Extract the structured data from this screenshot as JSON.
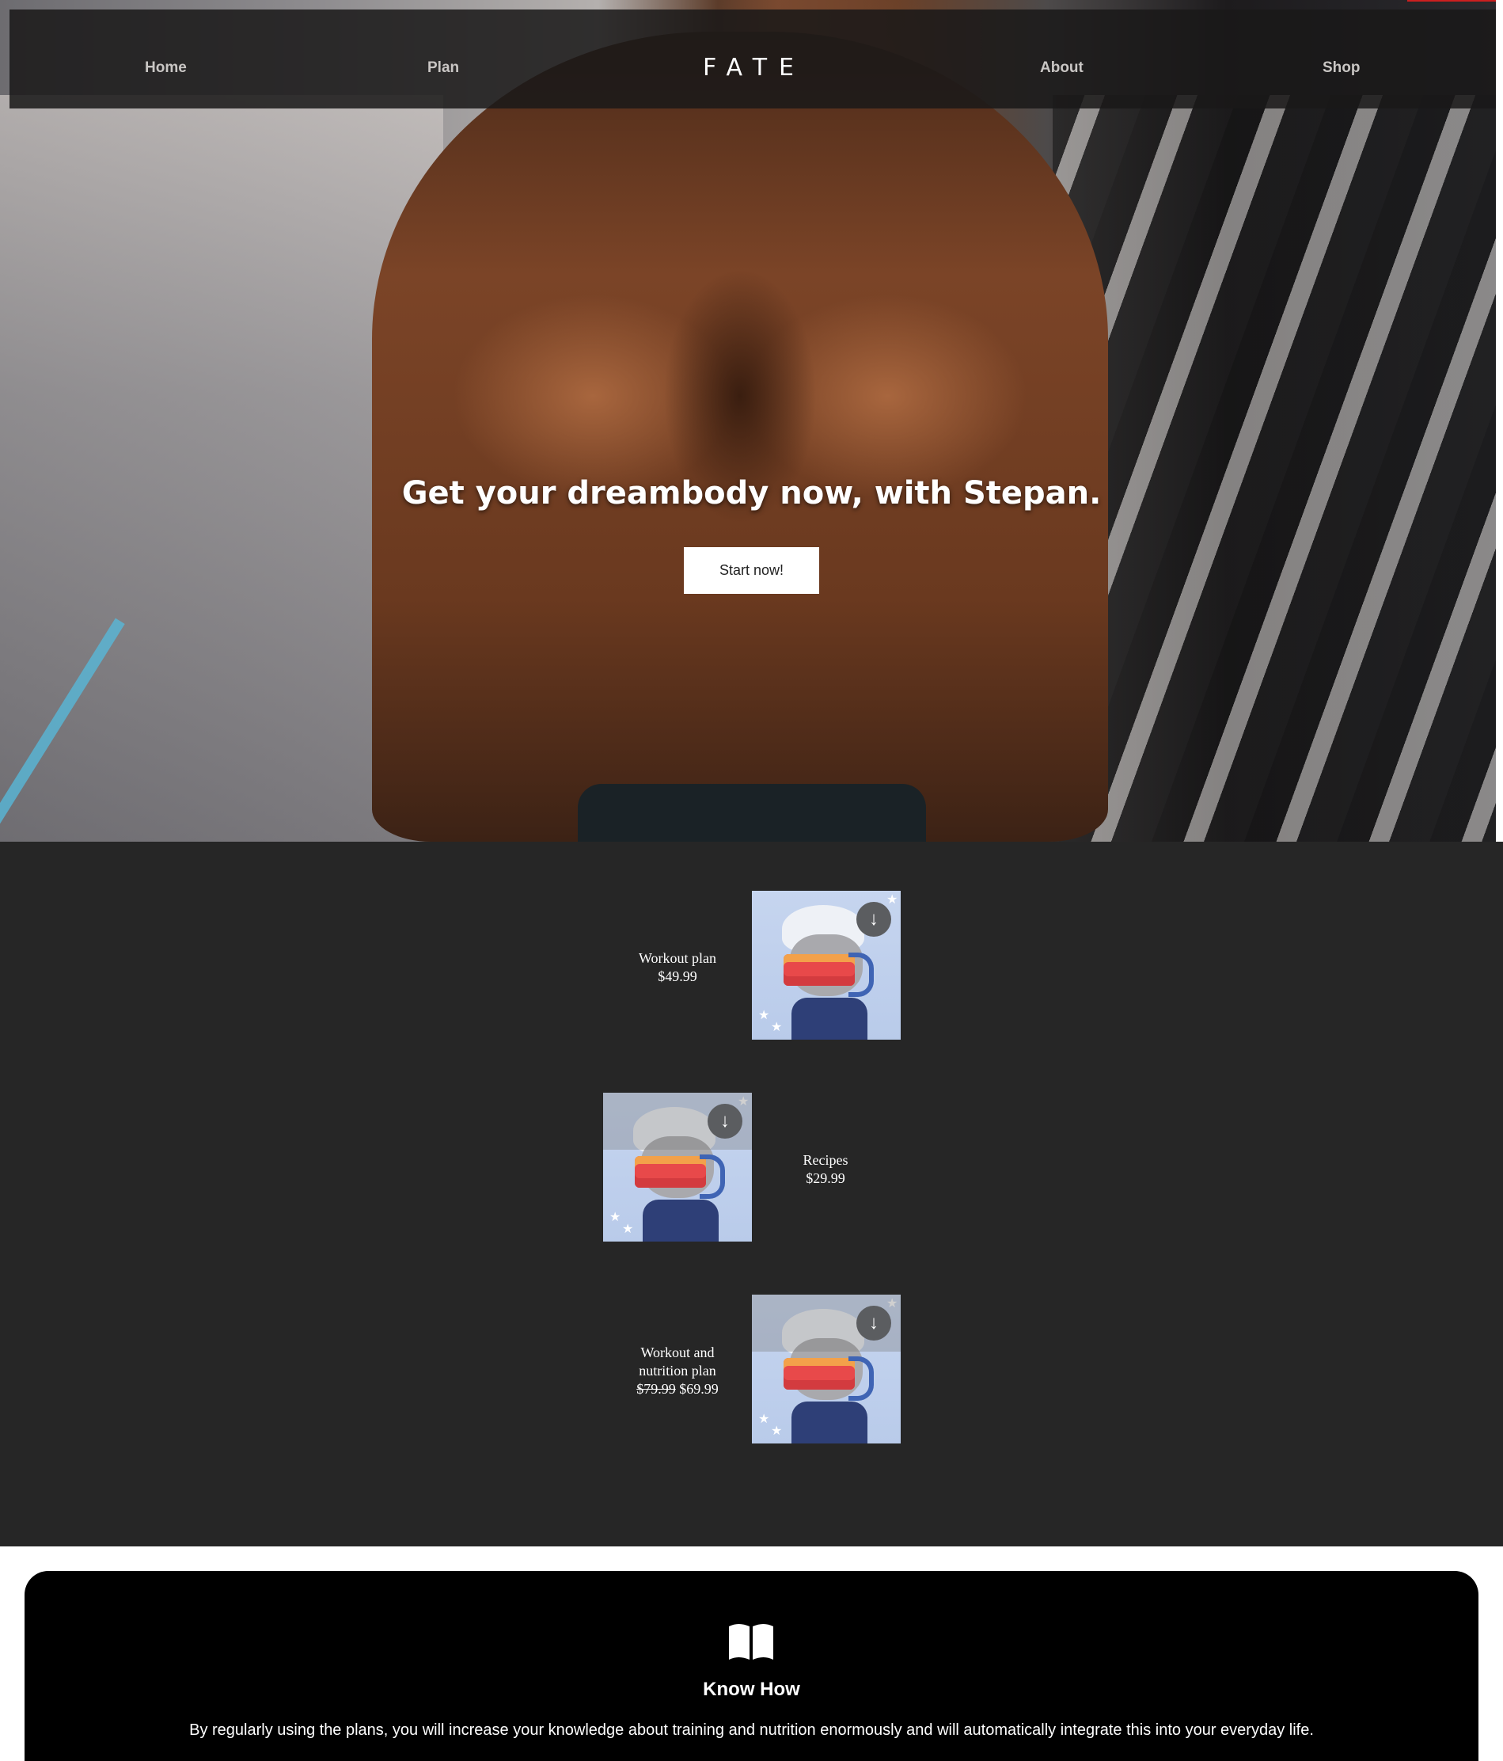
{
  "nav": {
    "home": "Home",
    "plan": "Plan",
    "logo": "FATE",
    "about": "About",
    "shop": "Shop"
  },
  "hero": {
    "headline": "Get your dreambody now, with Stepan.",
    "cta": "Start now!"
  },
  "products": [
    {
      "name": "Workout plan",
      "price": "$49.99",
      "download_icon": "download-icon"
    },
    {
      "name": "Recipes",
      "price": "$29.99",
      "download_icon": "download-icon"
    },
    {
      "name_line1": "Workout and",
      "name_line2": "nutrition plan",
      "old_price": "$79.99",
      "price": "$69.99",
      "download_icon": "download-icon"
    }
  ],
  "knowhow": {
    "icon": "book-icon",
    "title": "Know How",
    "text": "By regularly using the plans, you will increase your knowledge about training and nutrition enormously and will automatically integrate this into your everyday life."
  },
  "colors": {
    "dark_section": "#262626",
    "nav_bar": "#1a1818",
    "accent_red": "#cc1f1f",
    "card_black": "#000000"
  }
}
